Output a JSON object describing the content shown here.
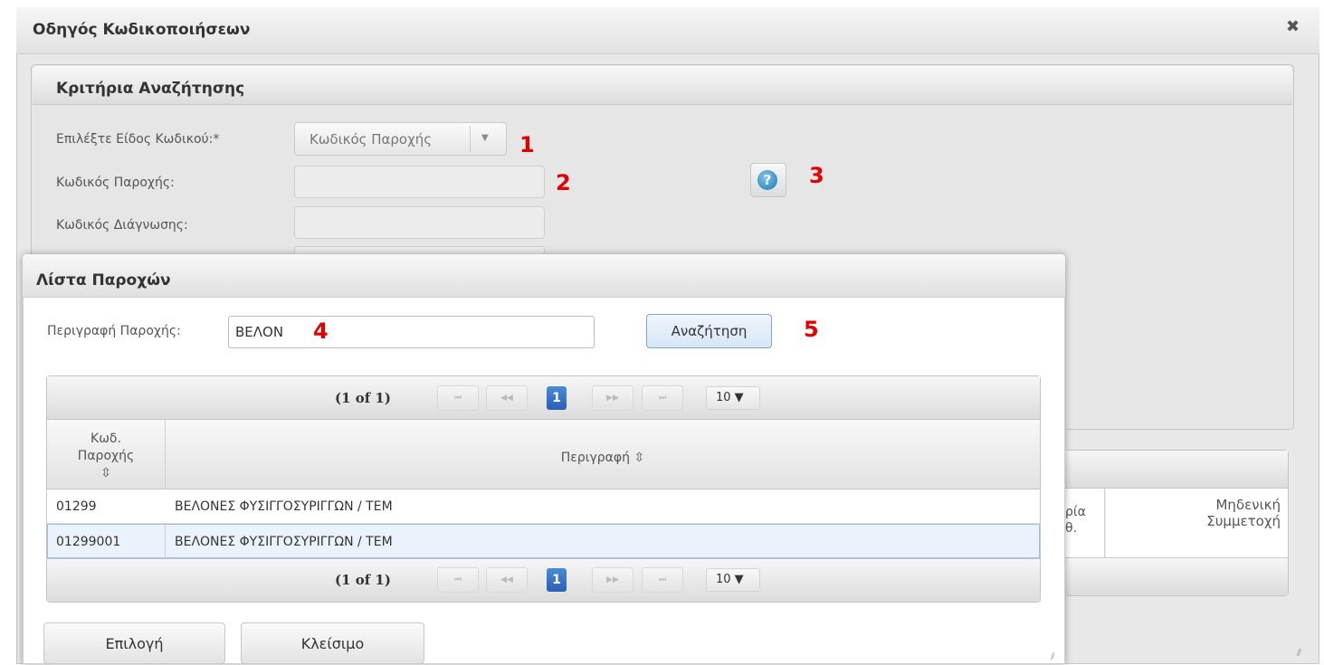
{
  "outer_dialog": {
    "title": "Οδηγός Κωδικοποιήσεων",
    "close_glyph": "✖",
    "criteria": {
      "header": "Κριτήρια Αναζήτησης",
      "type_label": "Επιλέξτε Είδος Κωδικού:*",
      "type_value": "Κωδικός Παροχής",
      "provision_code_label": "Κωδικός Παροχής:",
      "provision_code_value": "",
      "diagnosis_code_label": "Κωδικός Διάγνωσης:",
      "diagnosis_code_value": ""
    },
    "right_table": {
      "col_a_text": "ρία\nθ.",
      "col_b_text": "Μηδενική\nΣυμμετοχή"
    }
  },
  "annotations": [
    "1",
    "2",
    "3",
    "4",
    "5"
  ],
  "inner_dialog": {
    "title": "Λίστα Παροχών",
    "desc_label": "Περιγραφή Παροχής:",
    "desc_value": "ΒΕΛΟΝ",
    "search_button": "Αναζήτηση",
    "paginator": {
      "current": "(1 of 1)",
      "first": "⏮",
      "prev": "◀◀",
      "page": "1",
      "next": "▶▶",
      "last": "⏭",
      "rows_per_page": "10 ▼"
    },
    "columns": {
      "code": "Κωδ.\nΠαροχής\n⇳",
      "description": "Περιγραφή ⇳"
    },
    "rows": [
      {
        "code": "01299",
        "description": "ΒΕΛΟΝΕΣ ΦΥΣΙΓΓΟΣΥΡΙΓΓΩΝ / ΤΕΜ"
      },
      {
        "code": "01299001",
        "description": "ΒΕΛΟΝΕΣ ΦΥΣΙΓΓΟΣΥΡΙΓΓΩΝ / ΤΕΜ"
      }
    ],
    "select_button": "Επιλογή",
    "close_button": "Κλείσιμο"
  },
  "colors": {
    "annotation": "#e30000",
    "accent_blue": "#2a5fb5",
    "selected_row": "#eaf2fb"
  },
  "icons": {
    "help": "help-icon",
    "sort": "sort-icon",
    "close": "close-icon",
    "dropdown": "chevron-down-icon"
  }
}
